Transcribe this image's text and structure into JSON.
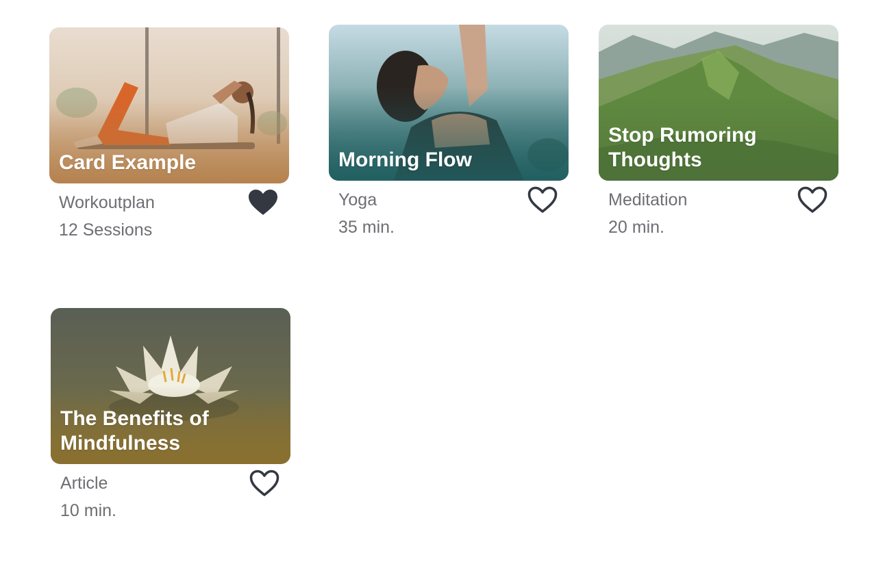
{
  "colors": {
    "meta_text": "#6e6e73",
    "heart": "#343841",
    "title_text": "#ffffff"
  },
  "cards": [
    {
      "title": "Card Example",
      "category": "Workoutplan",
      "detail": "12 Sessions",
      "favorited": true,
      "image_subject": "woman doing crunches on a mat",
      "heart_icon": "heart-filled-icon"
    },
    {
      "title": "Morning Flow",
      "category": "Yoga",
      "detail": "35 min.",
      "favorited": false,
      "image_subject": "woman stretching arm upward",
      "heart_icon": "heart-outline-icon"
    },
    {
      "title": "Stop Rumoring Thoughts",
      "category": "Meditation",
      "detail": "20 min.",
      "favorited": false,
      "image_subject": "green mountain ridge landscape",
      "heart_icon": "heart-outline-icon"
    },
    {
      "title": "The Benefits of Mindfulness",
      "category": "Article",
      "detail": "10 min.",
      "favorited": false,
      "image_subject": "white water lily on pond",
      "heart_icon": "heart-outline-icon"
    }
  ]
}
